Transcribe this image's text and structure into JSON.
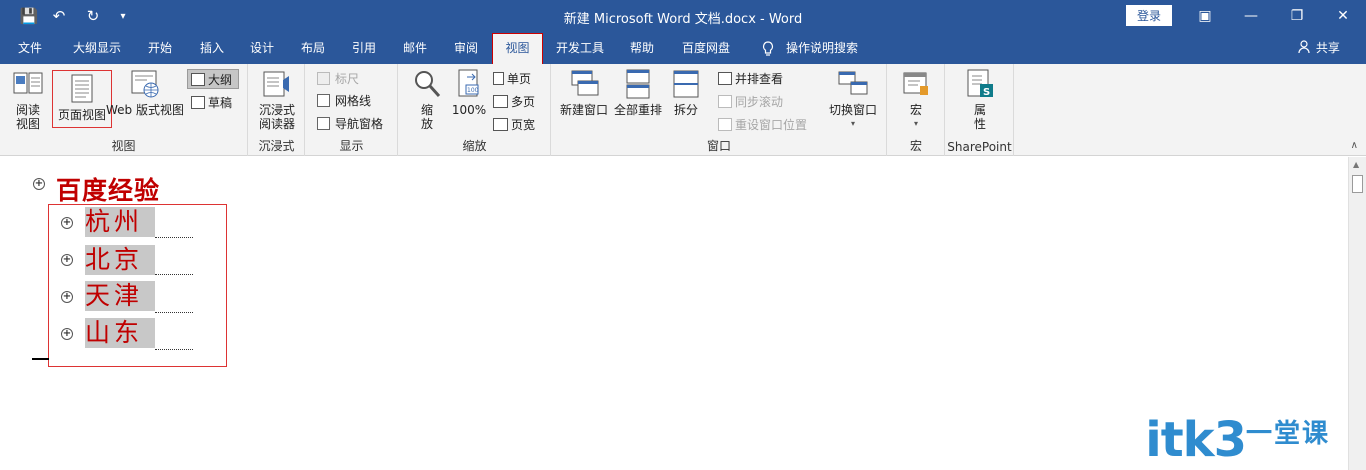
{
  "titlebar": {
    "title": "新建 Microsoft Word 文档.docx  -  Word",
    "login": "登录",
    "qa_save": "💾",
    "qa_undo": "↶",
    "qa_redo": "↻",
    "qa_more": "▾",
    "win_ribbon_opts": "▣",
    "win_min": "—",
    "win_restore": "❐",
    "win_close": "✕"
  },
  "tabs": [
    "文件",
    "大纲显示",
    "开始",
    "插入",
    "设计",
    "布局",
    "引用",
    "邮件",
    "审阅",
    "视图",
    "开发工具",
    "帮助",
    "百度网盘",
    "操作说明搜索"
  ],
  "active_tab": "视图",
  "share": "共享",
  "ribbon": {
    "views": {
      "label": "视图",
      "read_l1": "阅读",
      "read_l2": "视图",
      "print_layout": "页面视图",
      "web_layout": "Web 版式视图",
      "outline": "大纲",
      "draft": "草稿"
    },
    "immersive": {
      "label": "沉浸式",
      "reader_l1": "沉浸式",
      "reader_l2": "阅读器"
    },
    "show": {
      "label": "显示",
      "ruler": "标尺",
      "gridlines": "网格线",
      "nav_pane": "导航窗格"
    },
    "zoom": {
      "label": "缩放",
      "zoom_l1": "缩",
      "zoom_l2": "放",
      "hundred": "100%",
      "one_page": "单页",
      "multi_page": "多页",
      "page_width": "页宽"
    },
    "window": {
      "label": "窗口",
      "new_window": "新建窗口",
      "arrange_all": "全部重排",
      "split": "拆分",
      "side_by_side": "并排查看",
      "sync_scroll": "同步滚动",
      "reset_position": "重设窗口位置",
      "switch_windows": "切换窗口"
    },
    "macros": {
      "label": "宏",
      "macros": "宏"
    },
    "sharepoint": {
      "label": "SharePoint",
      "props_l1": "属",
      "props_l2": "性"
    }
  },
  "document": {
    "heading1": "百度经验",
    "items": [
      "杭州",
      "北京",
      "天津",
      "山东"
    ]
  },
  "watermark": {
    "brand": "itk3",
    "cn": "一堂课"
  }
}
